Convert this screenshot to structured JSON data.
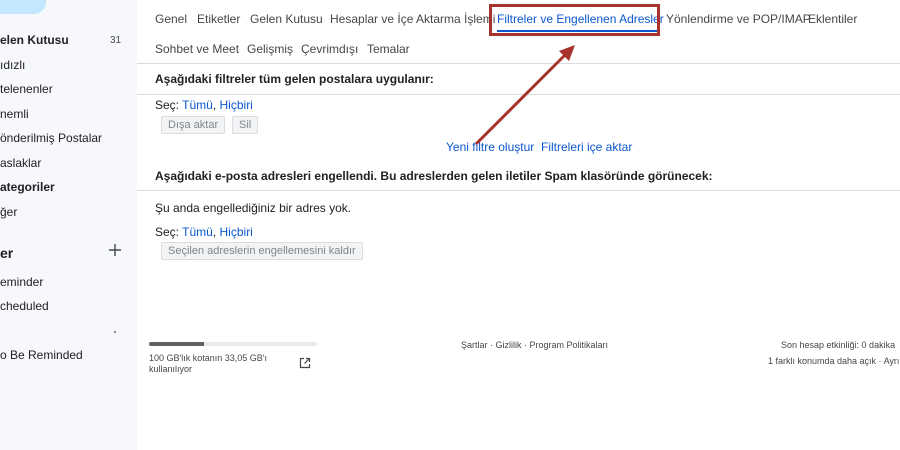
{
  "sidebar": {
    "items": [
      {
        "label": "elen Kutusu",
        "count": "31",
        "bold": true
      },
      {
        "label": "ıdızlı",
        "count": "",
        "bold": false
      },
      {
        "label": "telenenler",
        "count": "",
        "bold": false
      },
      {
        "label": "nemli",
        "count": "",
        "bold": false
      },
      {
        "label": "önderilmiş Postalar",
        "count": "",
        "bold": false
      },
      {
        "label": "aslaklar",
        "count": "",
        "bold": false
      },
      {
        "label": "ategoriler",
        "count": "",
        "bold": true
      },
      {
        "label": "ğer",
        "count": "",
        "bold": false
      }
    ],
    "labels_section": "er",
    "labels": [
      {
        "label": "eminder"
      },
      {
        "label": "cheduled"
      },
      {
        "label": "o Be Reminded"
      }
    ]
  },
  "tabs": [
    {
      "label": "Genel",
      "active": false
    },
    {
      "label": "Etiketler",
      "active": false
    },
    {
      "label": "Gelen Kutusu",
      "active": false
    },
    {
      "label": "Hesaplar ve İçe Aktarma İşlemi",
      "active": false
    },
    {
      "label": "Filtreler ve Engellenen Adresler",
      "active": true
    },
    {
      "label": "Yönlendirme ve POP/IMAP",
      "active": false
    },
    {
      "label": "Eklentiler",
      "active": false
    },
    {
      "label": "Sohbet ve Meet",
      "active": false
    },
    {
      "label": "Gelişmiş",
      "active": false
    },
    {
      "label": "Çevrimdışı",
      "active": false
    },
    {
      "label": "Temalar",
      "active": false
    }
  ],
  "filters": {
    "heading": "Aşağıdaki filtreler tüm gelen postalara uygulanır:",
    "select_label": "Seç:",
    "select_all": "Tümü",
    "select_sep": ",",
    "select_none": "Hiçbiri",
    "export_button": "Dışa aktar",
    "delete_button": "Sil",
    "create_link": "Yeni filtre oluştur",
    "import_link": "Filtreleri içe aktar"
  },
  "blocked": {
    "heading": "Aşağıdaki e-posta adresleri engellendi. Bu adreslerden gelen iletiler Spam klasöründe görünecek:",
    "empty_text": "Şu anda engellediğiniz bir adres yok.",
    "select_label": "Seç:",
    "select_all": "Tümü",
    "select_sep": ",",
    "select_none": "Hiçbiri",
    "unblock_button": "Seçilen adreslerin engellemesini kaldır"
  },
  "footer": {
    "storage_text": "100 GB'lık kotanın 33,05 GB'ı kullanılıyor",
    "storage_fraction": 0.33,
    "links": "Şartlar · Gizlilik · Program Politikaları",
    "last_activity": "Son hesap etkinliği: 0 dakika",
    "other_locations": "1 farklı konumda daha açık · Ayrı"
  },
  "colors": {
    "accent": "#0b57d0",
    "highlight": "#a8332b",
    "compose": "#c2e7ff"
  },
  "icons": {
    "add_label": "plus-icon",
    "open_storage": "external-link-icon"
  }
}
